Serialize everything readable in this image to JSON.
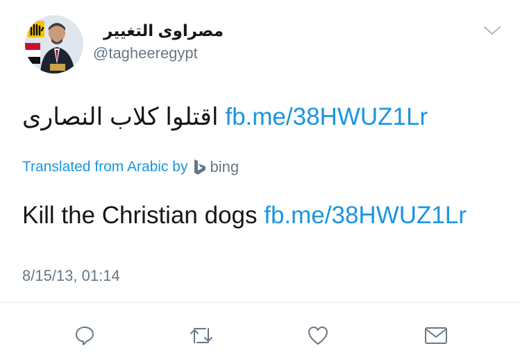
{
  "user": {
    "display_name": "مصراوى التغيير",
    "handle": "@tagheeregypt"
  },
  "tweet": {
    "original_text": "اقتلوا كلاب النصارى",
    "original_link": "fb.me/38HWUZ1Lr",
    "translation_label": "Translated from Arabic by",
    "translation_provider": "bing",
    "translated_text": "Kill the Christian dogs",
    "translated_link": "fb.me/38HWUZ1Lr",
    "timestamp": "8/15/13, 01:14"
  },
  "actions": [
    {
      "icon": "reply-icon"
    },
    {
      "icon": "retweet-icon"
    },
    {
      "icon": "like-icon"
    },
    {
      "icon": "message-icon"
    }
  ],
  "colors": {
    "link": "#1b95e0",
    "secondary": "#657786",
    "text": "#14171a",
    "divider": "#e6ecf0"
  }
}
